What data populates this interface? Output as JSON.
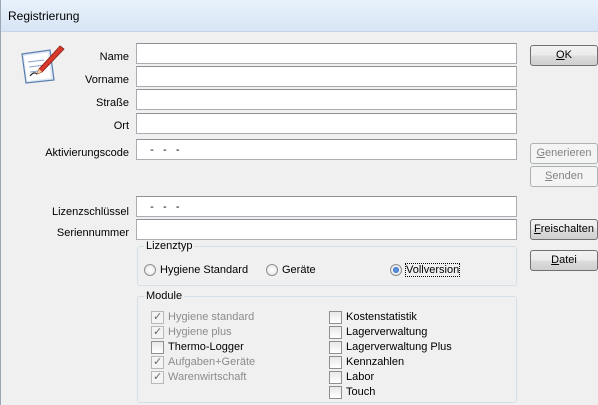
{
  "window": {
    "title": "Registrierung"
  },
  "form": {
    "name_label": "Name",
    "vorname_label": "Vorname",
    "strasse_label": "Straße",
    "ort_label": "Ort",
    "aktivierungscode_label": "Aktivierungscode",
    "aktivierungscode_value": "   -   -   -",
    "lizenzschluessel_label": "Lizenzschlüssel",
    "lizenzschluessel_value": "   -   -   -",
    "seriennummer_label": "Seriennummer"
  },
  "buttons": {
    "ok": {
      "mnemonic": "O",
      "rest": "K"
    },
    "generieren": {
      "mnemonic": "G",
      "rest": "enerieren"
    },
    "senden": {
      "mnemonic": "S",
      "rest": "enden"
    },
    "freischalten": {
      "mnemonic": "F",
      "rest": "reischalten"
    },
    "datei": {
      "mnemonic": "D",
      "rest": "atei"
    }
  },
  "lizenztyp": {
    "legend": "Lizenztyp",
    "options": [
      "Hygiene Standard",
      "Geräte",
      "Vollversion"
    ],
    "selected": "Vollversion"
  },
  "module": {
    "legend": "Module",
    "left": [
      {
        "label": "Hygiene standard",
        "checked": true,
        "enabled": false
      },
      {
        "label": "Hygiene plus",
        "checked": true,
        "enabled": false
      },
      {
        "label": "Thermo-Logger",
        "checked": false,
        "enabled": true
      },
      {
        "label": "Aufgaben+Geräte",
        "checked": true,
        "enabled": false
      },
      {
        "label": "Warenwirtschaft",
        "checked": true,
        "enabled": false
      }
    ],
    "right": [
      {
        "label": "Kostenstatistik",
        "checked": false,
        "enabled": true
      },
      {
        "label": "Lagerverwaltung",
        "checked": false,
        "enabled": true
      },
      {
        "label": "Lagerverwaltung Plus",
        "checked": false,
        "enabled": true
      },
      {
        "label": "Kennzahlen",
        "checked": false,
        "enabled": true
      },
      {
        "label": "Labor",
        "checked": false,
        "enabled": true
      },
      {
        "label": "Touch",
        "checked": false,
        "enabled": true
      }
    ]
  },
  "icons": {
    "app": "pen-paper-icon"
  }
}
